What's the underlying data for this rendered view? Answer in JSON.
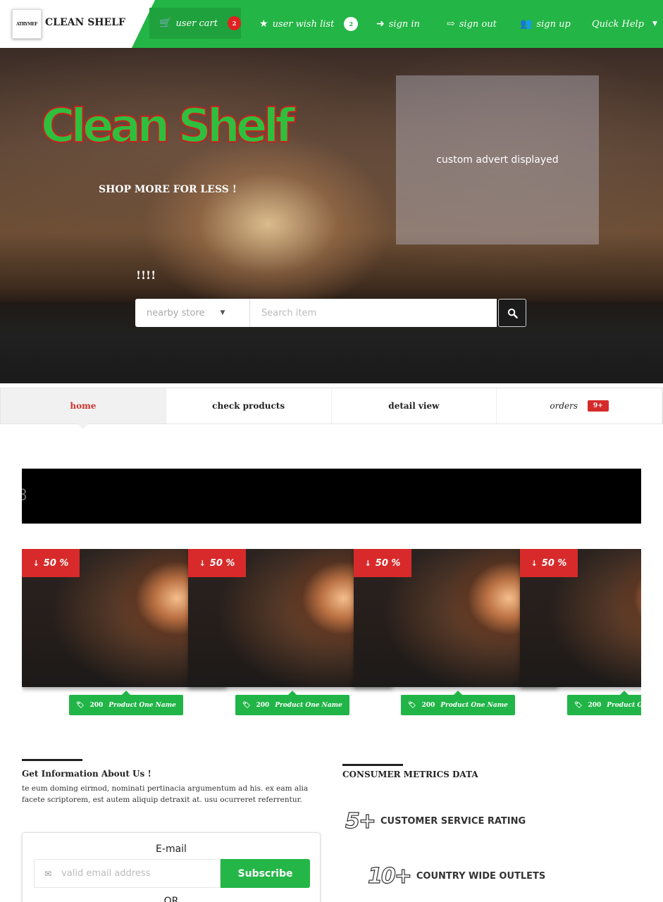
{
  "brand": {
    "logo_text": "ATRYMEF",
    "name": "CLEAN SHELF"
  },
  "nav": {
    "cart": {
      "label": "user cart",
      "count": "2"
    },
    "wishlist": {
      "label": "user wish list",
      "count": "2"
    },
    "signin": "sign in",
    "signout": "sign out",
    "signup": "sign up",
    "help": "Quick Help"
  },
  "hero": {
    "title": "Clean Shelf",
    "tagline": "SHOP MORE FOR LESS !",
    "exclaim": "!!!!",
    "advert": "custom advert displayed",
    "search": {
      "store_select": "nearby store",
      "placeholder": "Search item"
    }
  },
  "tabs": [
    {
      "label": "home",
      "active": true
    },
    {
      "label": "check products"
    },
    {
      "label": "detail view"
    },
    {
      "label": "orders",
      "badge": "9+"
    }
  ],
  "banner": {
    "text": "3"
  },
  "products": [
    {
      "discount": "50 %",
      "price": "200",
      "name": "Product One Name"
    },
    {
      "discount": "50 %",
      "price": "200",
      "name": "Product One Name"
    },
    {
      "discount": "50 %",
      "price": "200",
      "name": "Product One Name"
    },
    {
      "discount": "50 %",
      "price": "200",
      "name": "Product One Name"
    }
  ],
  "info": {
    "title": "Get Information About Us !",
    "body": "te eum doming eirmod, nominati pertinacia argumentum ad his. ex eam alia facete scriptorem, est autem aliquip detraxit at. usu ocurreret referrentur.",
    "email_label": "E-mail",
    "email_placeholder": "valid email address",
    "subscribe": "Subscribe",
    "or": "OR"
  },
  "metrics": {
    "title": "CONSUMER METRICS DATA",
    "items": [
      {
        "value": "5+",
        "label": "CUSTOMER SERVICE RATING"
      },
      {
        "value": "10+",
        "label": "COUNTRY WIDE OUTLETS"
      }
    ]
  },
  "colors": {
    "brand_green": "#23b545",
    "alert_red": "#d82a2a"
  }
}
